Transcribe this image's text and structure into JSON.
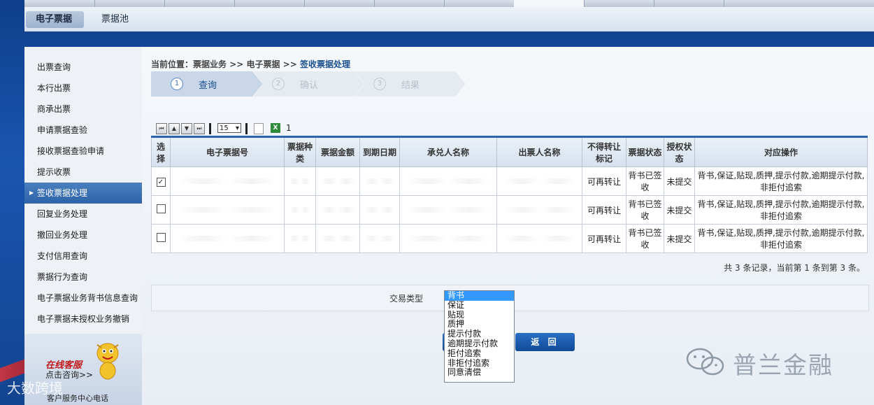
{
  "subnav": {
    "tabs": [
      "电子票据",
      "票据池"
    ]
  },
  "sidebar": {
    "items": [
      "出票查询",
      "本行出票",
      "商承出票",
      "申请票据查验",
      "接收票据查验申请",
      "提示收票",
      "签收票据处理",
      "回复业务处理",
      "撤回业务处理",
      "支付信用查询",
      "票据行为查询",
      "电子票据业务背书信息查询",
      "电子票据未授权业务撤销"
    ],
    "active_index": 6,
    "cs_title": "在线客服",
    "cs_link": "点击咨询>>",
    "cs_tel": "客户服务中心电话"
  },
  "breadcrumb": {
    "prefix": "当前位置：",
    "path": "票据业务 >> 电子票据 >> ",
    "current": "签收票据处理"
  },
  "steps": [
    {
      "num": "1",
      "label": "查询"
    },
    {
      "num": "2",
      "label": "确认"
    },
    {
      "num": "3",
      "label": "结果"
    }
  ],
  "pager": {
    "page_size": "15",
    "page": "1"
  },
  "table": {
    "headers": [
      "选择",
      "电子票据号",
      "票据种类",
      "票据金额",
      "到期日期",
      "承兑人名称",
      "出票人名称",
      "不得转让标记",
      "票据状态",
      "授权状态",
      "对应操作"
    ],
    "rows": [
      {
        "checked": "✓",
        "transfer": "可再转让",
        "status": "背书已签收",
        "auth": "未提交",
        "ops": "背书,保证,贴现,质押,提示付款,逾期提示付款,非拒付追索"
      },
      {
        "checked": "",
        "transfer": "可再转让",
        "status": "背书已签收",
        "auth": "未提交",
        "ops": "背书,保证,贴现,质押,提示付款,逾期提示付款,非拒付追索"
      },
      {
        "checked": "",
        "transfer": "可再转让",
        "status": "背书已签收",
        "auth": "未提交",
        "ops": "背书,保证,贴现,质押,提示付款,逾期提示付款,非拒付追索"
      }
    ]
  },
  "summary": "共 3 条记录，当前第 1 条到第 3 条。",
  "form": {
    "label": "交易类型",
    "options": [
      "背书",
      "保证",
      "贴现",
      "质押",
      "提示付款",
      "逾期提示付款",
      "拒付追索",
      "非拒付追索",
      "同意清偿"
    ],
    "selected_index": 0
  },
  "buttons": {
    "back": "返 回"
  },
  "watermark": "普兰金融",
  "watermark2": "大数跨境",
  "colors": {
    "accent": "#2d63a8",
    "button": "#1a5cb5",
    "dropdown_selected": "#3399ff"
  }
}
